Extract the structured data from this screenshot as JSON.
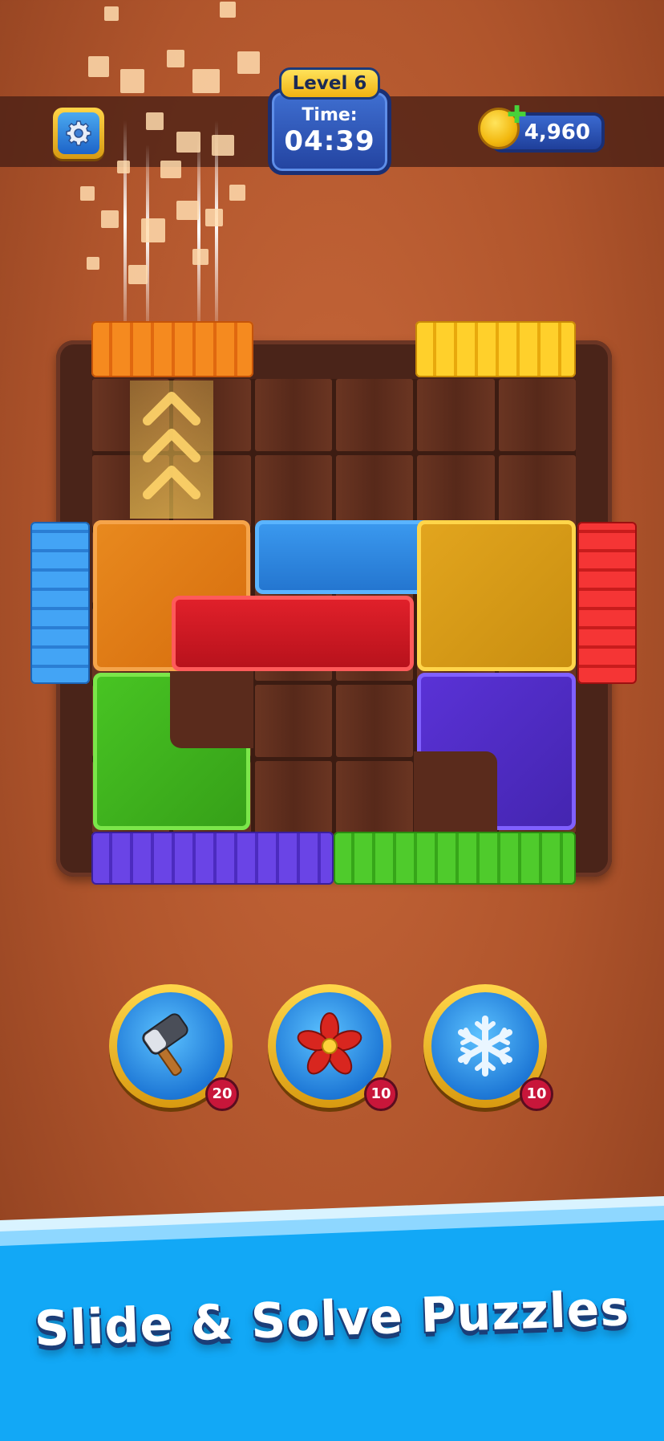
{
  "hud": {
    "level_label": "Level 6",
    "time_label": "Time:",
    "time_value": "04:39",
    "coins": "4,960",
    "icons": [
      "gear-icon",
      "coin-icon",
      "plus-icon"
    ]
  },
  "colors": {
    "orange": "#f07a14",
    "yellow": "#f5c51b",
    "blue": "#2d8be6",
    "red": "#e0202a",
    "green": "#45c124",
    "purple": "#5a32d6"
  },
  "powerups": [
    {
      "icon": "hammer-icon",
      "count": "20"
    },
    {
      "icon": "fan-icon",
      "count": "10"
    },
    {
      "icon": "snowflake-icon",
      "count": "10"
    }
  ],
  "banner": {
    "title": "Slide & Solve Puzzles"
  }
}
